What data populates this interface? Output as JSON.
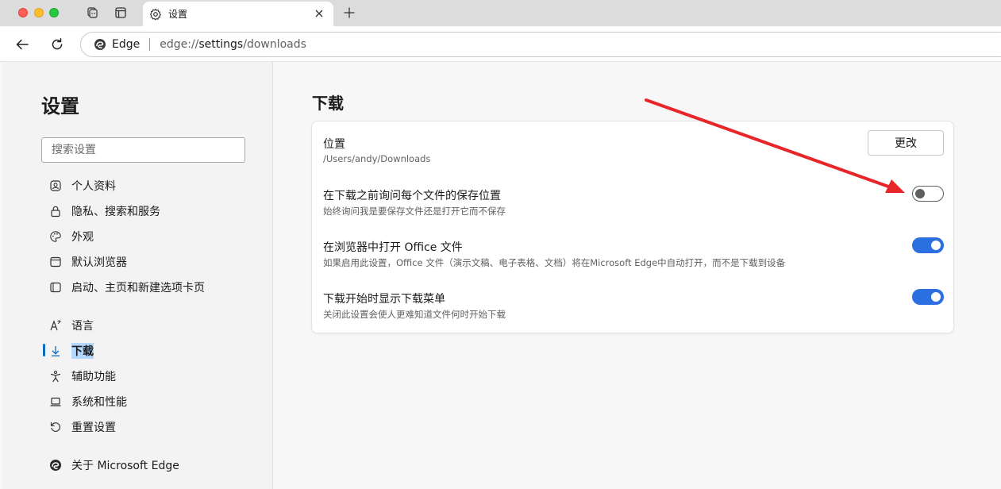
{
  "window": {
    "tab_title": "设置",
    "icons": [
      "workspaces-icon",
      "tab-actions-icon",
      "gear-icon",
      "close-icon",
      "plus-icon"
    ]
  },
  "toolbar": {
    "site_name": "Edge",
    "url_scheme": "edge://",
    "url_host": "settings",
    "url_path": "/downloads"
  },
  "sidebar": {
    "title": "设置",
    "search_placeholder": "搜索设置",
    "items": [
      {
        "label": "个人资料",
        "icon": "profile-icon"
      },
      {
        "label": "隐私、搜索和服务",
        "icon": "lock-icon"
      },
      {
        "label": "外观",
        "icon": "palette-icon"
      },
      {
        "label": "默认浏览器",
        "icon": "browser-icon"
      },
      {
        "label": "启动、主页和新建选项卡页",
        "icon": "home-icon"
      },
      {
        "label": "语言",
        "icon": "language-icon"
      },
      {
        "label": "下载",
        "icon": "download-icon",
        "active": true
      },
      {
        "label": "辅助功能",
        "icon": "accessibility-icon"
      },
      {
        "label": "系统和性能",
        "icon": "laptop-icon"
      },
      {
        "label": "重置设置",
        "icon": "reset-icon"
      },
      {
        "label": "关于 Microsoft Edge",
        "icon": "edge-logo-icon"
      }
    ]
  },
  "main": {
    "page_title": "下载",
    "rows": [
      {
        "title": "位置",
        "subtitle": "/Users/andy/Downloads",
        "control": "button",
        "button_label": "更改"
      },
      {
        "title": "在下载之前询问每个文件的保存位置",
        "subtitle": "始终询问我是要保存文件还是打开它而不保存",
        "control": "toggle",
        "checked": false
      },
      {
        "title": "在浏览器中打开 Office 文件",
        "subtitle": "如果启用此设置，Office 文件（演示文稿、电子表格、文档）将在Microsoft Edge中自动打开，而不是下载到设备",
        "control": "toggle",
        "checked": true
      },
      {
        "title": "下载开始时显示下载菜单",
        "subtitle": "关闭此设置会使人更难知道文件何时开始下载",
        "control": "toggle",
        "checked": true
      }
    ]
  },
  "annotation": {
    "arrow_color": "#e8262a"
  },
  "colors": {
    "accent": "#2b6fe0",
    "active_nav": "#0f6cbd",
    "highlight": "#b3d7ff"
  }
}
